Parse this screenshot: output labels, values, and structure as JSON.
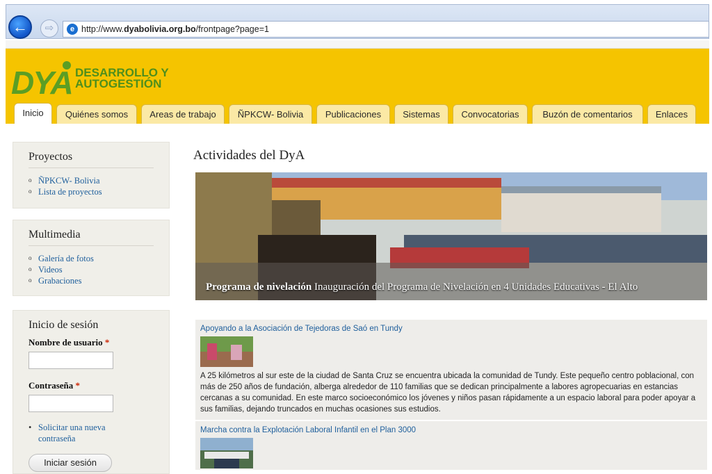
{
  "browser": {
    "url_prefix": "http://www.",
    "url_domain": "dyabolivia.org.bo",
    "url_path": "/frontpage?page=1",
    "back_icon": "back-arrow-icon",
    "forward_icon": "forward-arrow-icon"
  },
  "header": {
    "logo_mark": "DYA",
    "logo_line1": "DESARROLLO Y",
    "logo_line2": "AUTOGESTIÓN",
    "brand_color": "#f5c400",
    "logo_color": "#5b9e24"
  },
  "tabs": [
    {
      "label": "Inicio",
      "active": true
    },
    {
      "label": "Quiénes somos"
    },
    {
      "label": "Areas de trabajo"
    },
    {
      "label": "ÑPKCW- Bolivia"
    },
    {
      "label": "Publicaciones"
    },
    {
      "label": "Sistemas"
    },
    {
      "label": "Convocatorias"
    },
    {
      "label": "Buzón de comentarios"
    },
    {
      "label": "Enlaces"
    }
  ],
  "sidebar": {
    "projects": {
      "title": "Proyectos",
      "items": [
        "ÑPKCW- Bolivia",
        "Lista de proyectos"
      ]
    },
    "multimedia": {
      "title": "Multimedia",
      "items": [
        "Galería de fotos",
        "Videos",
        "Grabaciones"
      ]
    },
    "login": {
      "title": "Inicio de sesión",
      "username_label": "Nombre de usuario",
      "password_label": "Contraseña",
      "required_mark": "*",
      "reset_link_line1": "Solicitar una nueva",
      "reset_link_line2": "contraseña",
      "submit_label": "Iniciar sesión"
    }
  },
  "main": {
    "title": "Actividades del DyA",
    "slideshow": {
      "caption_bold": "Programa de nivelación",
      "caption_text": " Inauguración del Programa de Nivelación en 4 Unidades Educativas - El Alto"
    },
    "news": [
      {
        "title": "Apoyando a la Asociación de Tejedoras de Saó en Tundy",
        "body": "A 25 kilómetros al sur este de la ciudad de Santa Cruz se encuentra ubicada la comunidad de Tundy. Este pequeño centro poblacional, con más de 250 años de fundación, alberga alrededor de 110 familias que se dedican principalmente a labores agropecuarias en estancias cercanas a su comunidad. En este marco socioeconómico los jóvenes y niños pasan rápidamente a un espacio laboral para poder apoyar a sus familias, dejando truncados en muchas ocasiones sus estudios."
      },
      {
        "title": "Marcha contra la Explotación Laboral Infantil en el Plan 3000",
        "body": ""
      }
    ]
  }
}
